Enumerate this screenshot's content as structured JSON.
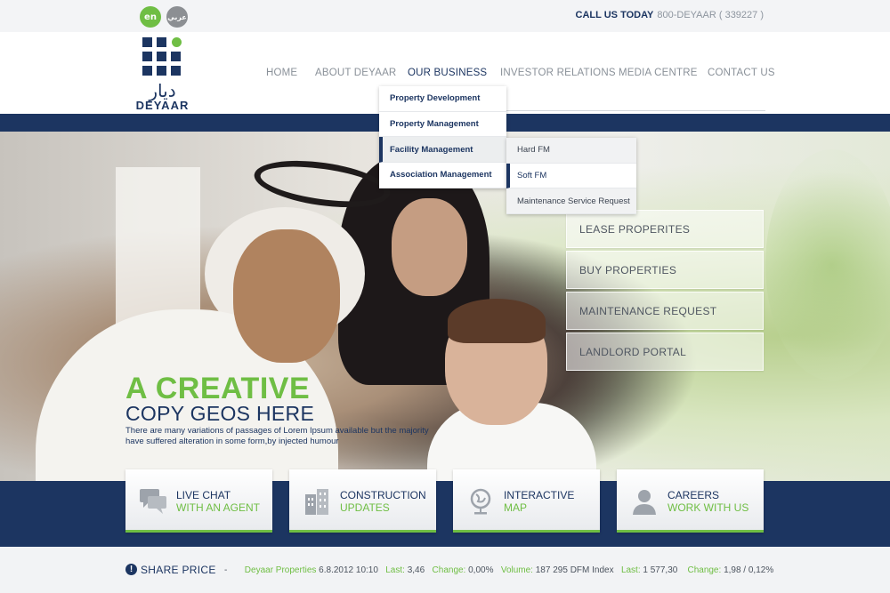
{
  "top": {
    "lang_en": "en",
    "lang_ar": "عربي",
    "call_label": "CALL US TODAY",
    "call_number": "800-DEYAAR ( 339227 )"
  },
  "logo": {
    "arabic": "ديار",
    "word": "DEYAAR"
  },
  "nav": {
    "home": "HOME",
    "about": "ABOUT DEYAAR",
    "business": "OUR BUSINESS",
    "investor": "INVESTOR RELATIONS",
    "media": "MEDIA CENTRE",
    "contact": "CONTACT US"
  },
  "business_menu": {
    "items": [
      "Property Development",
      "Property Management",
      "Facility Management",
      "Association Management"
    ],
    "selected": "Facility Management"
  },
  "facility_menu": {
    "items": [
      "Hard FM",
      "Soft FM",
      "Maintenance Service Request"
    ],
    "selected": "Soft FM"
  },
  "quick_links": [
    "LEASE PROPERITES",
    "BUY PROPERTIES",
    "MAINTENANCE REQUEST",
    "LANDLORD PORTAL"
  ],
  "hero": {
    "headline_1": "A CREATIVE",
    "headline_2": "COPY GEOS HERE",
    "body": "There are many variations of passages of Lorem Ipsum available but the majority have suffered alteration in some form,by injected humour"
  },
  "cards": [
    {
      "title": "LIVE CHAT",
      "subtitle": "WITH AN AGENT",
      "icon": "chat-icon"
    },
    {
      "title": "CONSTRUCTION",
      "subtitle": "UPDATES",
      "icon": "building-icon"
    },
    {
      "title": "INTERACTIVE",
      "subtitle": "MAP",
      "icon": "globe-icon"
    },
    {
      "title": "CAREERS",
      "subtitle": "WORK WITH US",
      "icon": "person-icon"
    }
  ],
  "share": {
    "icon_text": "!",
    "label": "SHARE PRICE",
    "dash": "-",
    "company": "Deyaar Properties",
    "datetime": "6.8.2012 10:10",
    "last_label": "Last:",
    "last_value": "3,46",
    "change_label": "Change:",
    "change_value": "0,00%",
    "volume_label": "Volume:",
    "volume_value": "187 295",
    "index_name": "DFM Index",
    "index_last_label": "Last:",
    "index_last_value": "1 577,30",
    "index_change_label": "Change:",
    "index_change_value": "1,98 / 0,12%"
  },
  "colors": {
    "brand_blue": "#1c3561",
    "brand_green": "#6fbe44"
  }
}
